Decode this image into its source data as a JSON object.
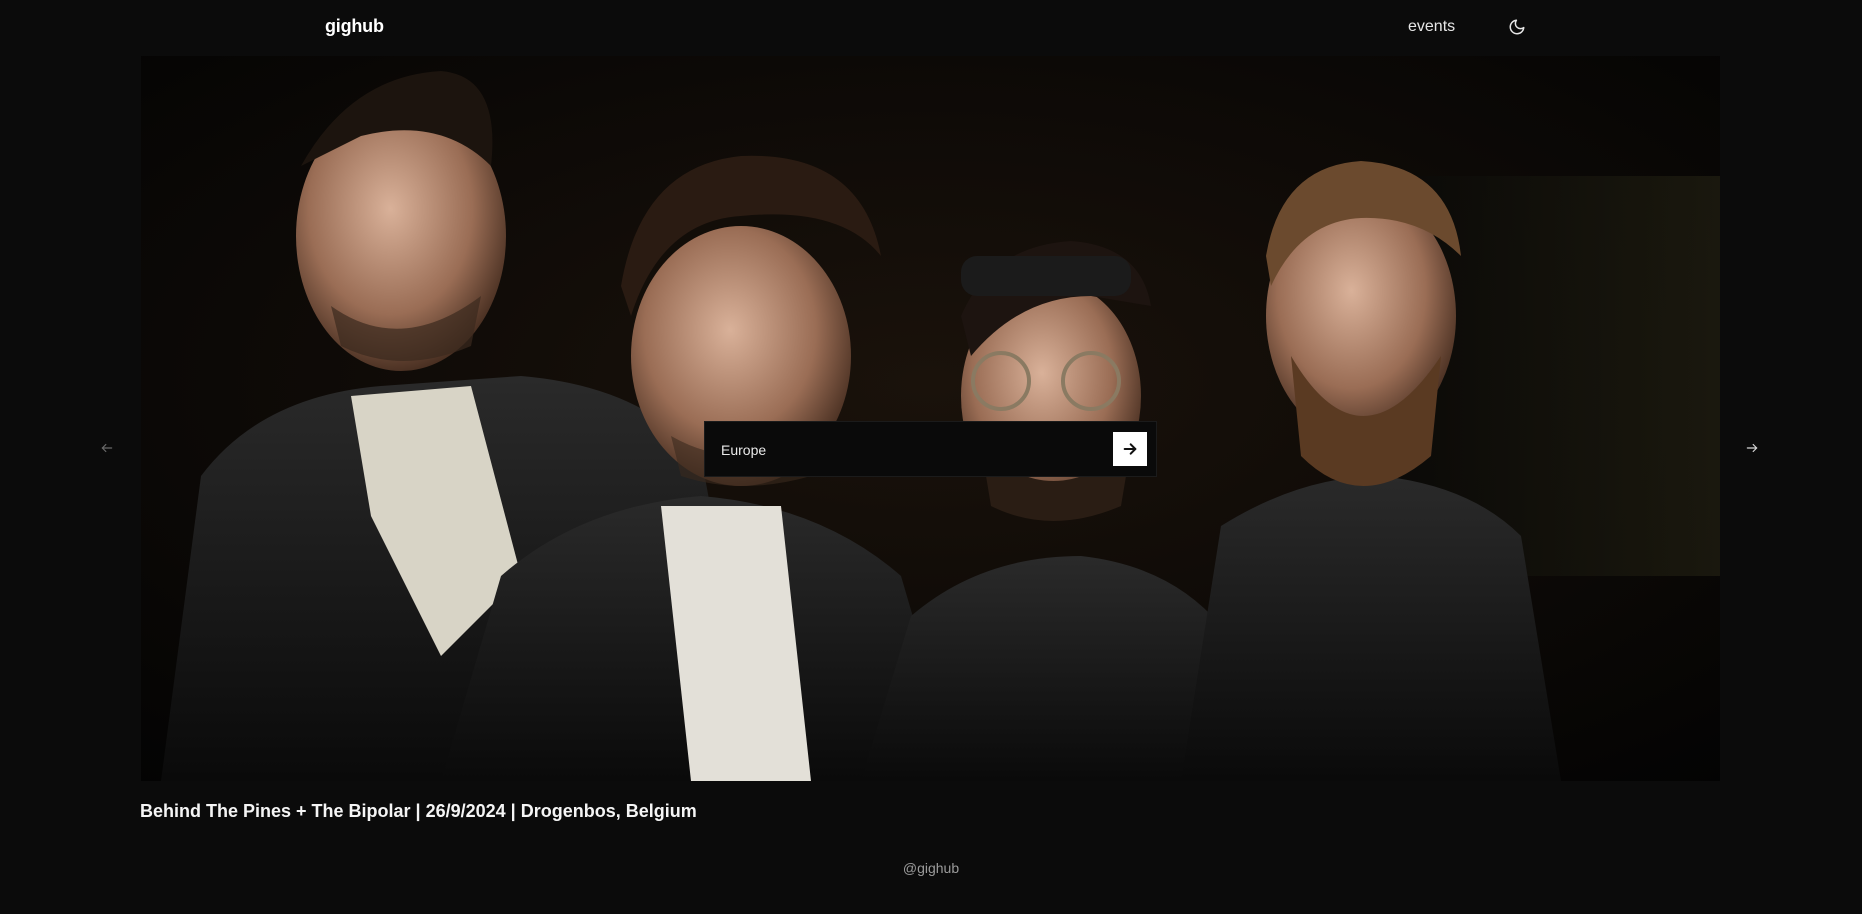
{
  "header": {
    "logo": "gighub",
    "nav": {
      "events_label": "events"
    },
    "theme_toggle_icon": "moon-icon"
  },
  "hero": {
    "image_description_icon": "band-photo",
    "prev_icon": "arrow-left-icon",
    "next_icon": "arrow-right-icon"
  },
  "search": {
    "value": "Europe",
    "placeholder": "",
    "submit_icon": "arrow-right-icon"
  },
  "event": {
    "caption": "Behind The Pines + The Bipolar | 26/9/2024 | Drogenbos, Belgium"
  },
  "footer": {
    "text": "@gighub"
  },
  "colors": {
    "background": "#0b0b0b",
    "text": "#f2f2f2",
    "muted": "#9b9b9b",
    "search_button": "#ffffff"
  }
}
